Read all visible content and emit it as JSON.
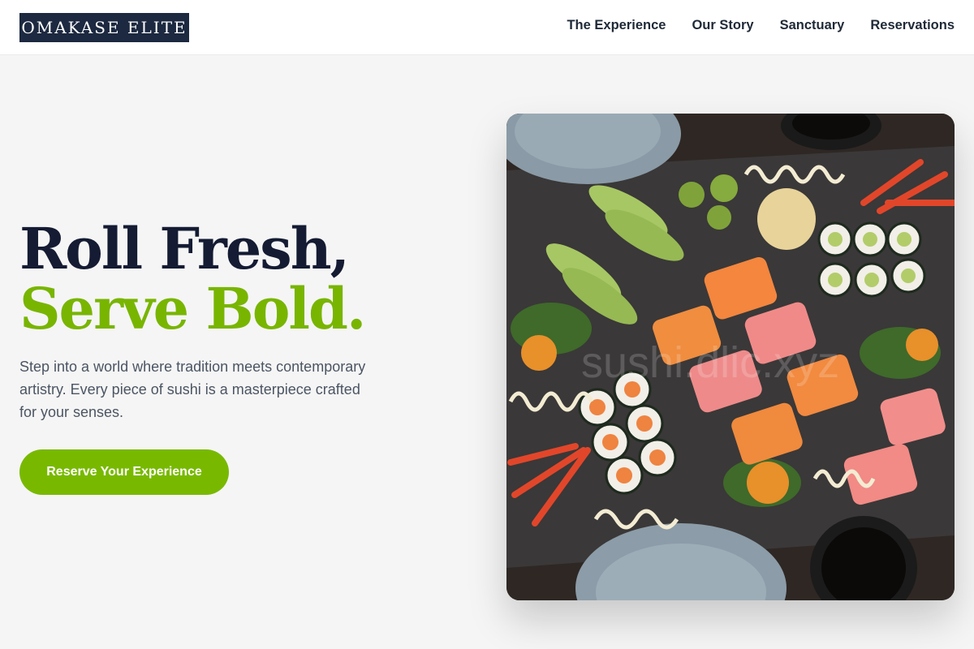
{
  "header": {
    "logo_text": "OMAKASE ELITE",
    "nav": [
      {
        "label": "The Experience"
      },
      {
        "label": "Our Story"
      },
      {
        "label": "Sanctuary"
      },
      {
        "label": "Reservations"
      }
    ]
  },
  "hero": {
    "title_line1": "Roll Fresh,",
    "title_line2": "Serve Bold.",
    "description": "Step into a world where tradition meets contemporary artistry. Every piece of sushi is a masterpiece crafted for your senses.",
    "cta_label": "Reserve Your Experience",
    "image_watermark": "sushi.dlic.xyz"
  },
  "colors": {
    "brand_dark": "#1c2940",
    "accent_green": "#78b900",
    "title_dark": "#141b33",
    "text_gray": "#4b5563"
  }
}
